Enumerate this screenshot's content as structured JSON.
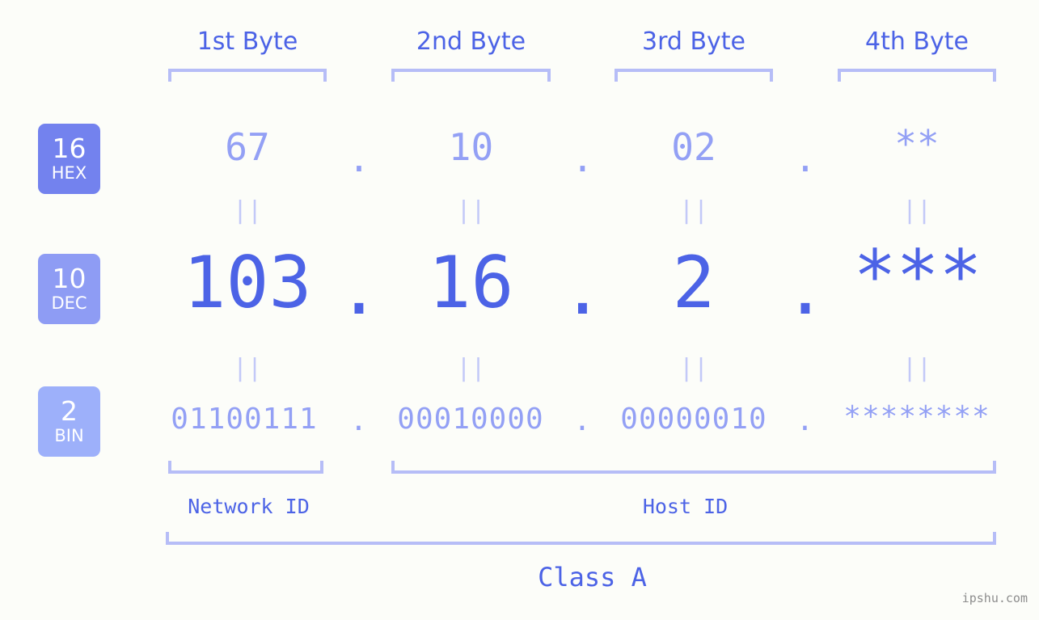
{
  "page": {
    "background_color": "#fcfdf9",
    "accent_color": "#4c63e6",
    "muted_accent_color": "#93a0f5",
    "bracket_color": "#b6bdf7",
    "watermark": "ipshu.com"
  },
  "byte_headers": [
    {
      "label": "1st Byte"
    },
    {
      "label": "2nd Byte"
    },
    {
      "label": "3rd Byte"
    },
    {
      "label": "4th Byte"
    }
  ],
  "bases": [
    {
      "number": "16",
      "name": "HEX",
      "color": "#7382ee"
    },
    {
      "number": "10",
      "name": "DEC",
      "color": "#8e9cf4"
    },
    {
      "number": "2",
      "name": "BIN",
      "color": "#9db0fa"
    }
  ],
  "rows": {
    "hex": {
      "base_number": "16",
      "base_name": "HEX",
      "values": [
        "67",
        "10",
        "02",
        "**"
      ],
      "separators": [
        ".",
        ".",
        "."
      ]
    },
    "dec": {
      "base_number": "10",
      "base_name": "DEC",
      "values": [
        "103",
        "16",
        "2",
        "***"
      ],
      "separators": [
        ".",
        ".",
        "."
      ]
    },
    "bin": {
      "base_number": "2",
      "base_name": "BIN",
      "values": [
        "01100111",
        "00010000",
        "00000010",
        "********"
      ],
      "separators": [
        ".",
        ".",
        "."
      ]
    }
  },
  "equality_separators": {
    "glyph": "||",
    "count_per_gap": 4
  },
  "sections": {
    "network_id": "Network ID",
    "host_id": "Host ID",
    "class": "Class A"
  }
}
